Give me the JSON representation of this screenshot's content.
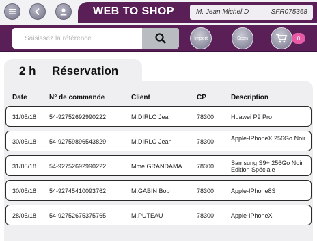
{
  "header": {
    "title": "WEB TO SHOP",
    "user_name": "M. Jean Michel D",
    "user_code": "SFR075368"
  },
  "search": {
    "placeholder": "Saisissez la référence",
    "import_label": "Import",
    "scan_label": "Scan",
    "cart_count": "0"
  },
  "section": {
    "time": "2 h",
    "title": "Réservation"
  },
  "table": {
    "columns": [
      "Date",
      "N° de commande",
      "Client",
      "CP",
      "Description"
    ],
    "rows": [
      {
        "date": "31/05/18",
        "order": "54-92752692990222",
        "client": "M.DIRLO Jean",
        "cp": "78300",
        "desc": "Huawei P9 Pro"
      },
      {
        "date": "30/05/18",
        "order": "54-92759896543829",
        "client": "M.DIRLO Jean",
        "cp": "78300",
        "desc": "Apple-IPhoneX 256Go Noir"
      },
      {
        "date": "31/05/18",
        "order": "54-92752692990222",
        "client": "Mme.GRANDAMA...",
        "cp": "78300",
        "desc": "Samsung S9+ 256Go Noir Edition Spéciale"
      },
      {
        "date": "30/05/18",
        "order": "54-92745410093762",
        "client": "M.GABIN Bob",
        "cp": "78300",
        "desc": "Apple-IPhone8S"
      },
      {
        "date": "28/05/18",
        "order": "54-92752675375765",
        "client": "M.PUTEAU",
        "cp": "78300",
        "desc": "Apple-IPhoneX"
      }
    ]
  },
  "colors": {
    "brand": "#5b1f58",
    "panel": "#efeff1",
    "badge": "#e75aa5"
  },
  "icons": [
    "menu-icon",
    "back-icon",
    "user-icon",
    "search-icon",
    "cart-icon"
  ]
}
